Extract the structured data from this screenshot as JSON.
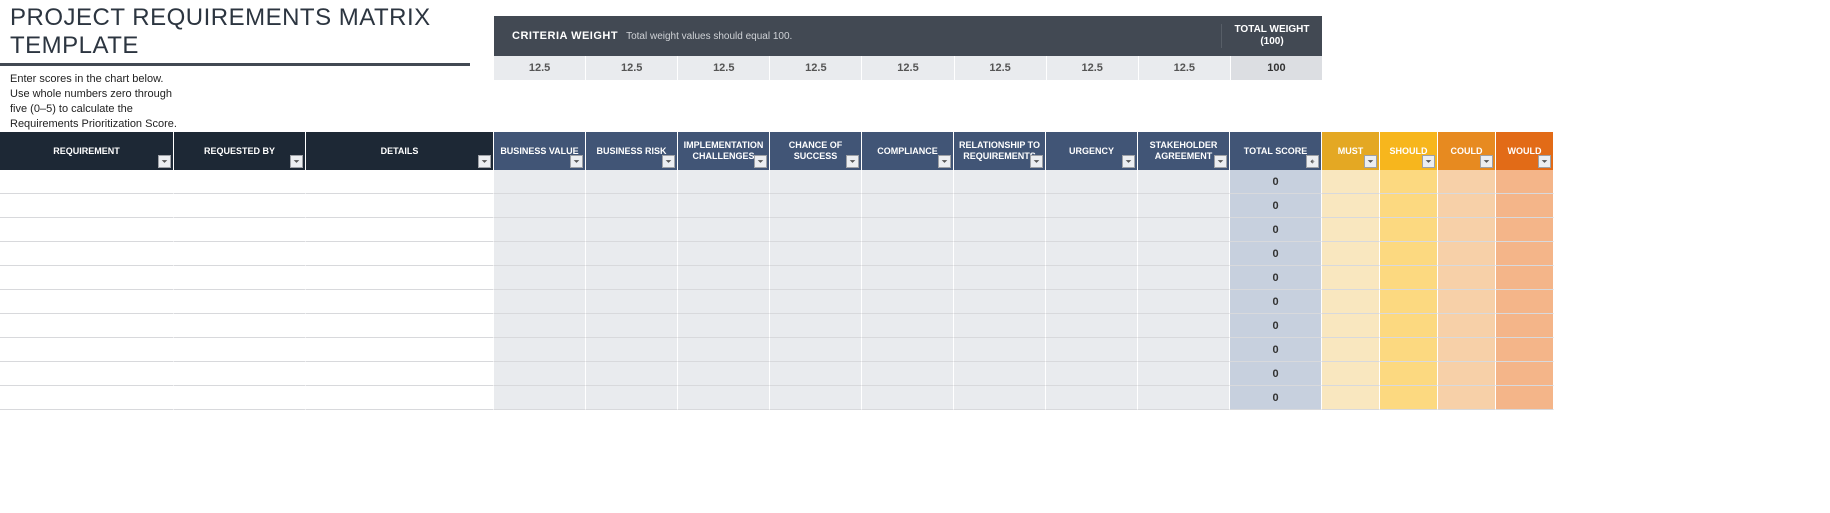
{
  "title": "PROJECT REQUIREMENTS MATRIX TEMPLATE",
  "instructions": {
    "l1": "Enter scores in the chart below.",
    "l2": "Use whole numbers zero through",
    "l3": "five (0–5) to calculate the",
    "l4": "Requirements Prioritization Score."
  },
  "criteria_weight": {
    "label": "CRITERIA WEIGHT",
    "hint": "Total weight values should equal 100.",
    "total_label": "TOTAL WEIGHT (100)",
    "weights": [
      "12.5",
      "12.5",
      "12.5",
      "12.5",
      "12.5",
      "12.5",
      "12.5",
      "12.5"
    ],
    "weights_total": "100"
  },
  "headers": {
    "requirement": "REQUIREMENT",
    "requested_by": "REQUESTED BY",
    "details": "DETAILS",
    "criteria": [
      "BUSINESS VALUE",
      "BUSINESS RISK",
      "IMPLEMENTATION CHALLENGES",
      "CHANCE OF SUCCESS",
      "COMPLIANCE",
      "RELATIONSHIP TO REQUIREMENTS",
      "URGENCY",
      "STAKEHOLDER AGREEMENT"
    ],
    "total_score": "TOTAL SCORE",
    "moscow": {
      "must": "MUST",
      "should": "SHOULD",
      "could": "COULD",
      "would": "WOULD"
    }
  },
  "rows": [
    {
      "total": "0"
    },
    {
      "total": "0"
    },
    {
      "total": "0"
    },
    {
      "total": "0"
    },
    {
      "total": "0"
    },
    {
      "total": "0"
    },
    {
      "total": "0"
    },
    {
      "total": "0"
    },
    {
      "total": "0"
    },
    {
      "total": "0"
    }
  ]
}
